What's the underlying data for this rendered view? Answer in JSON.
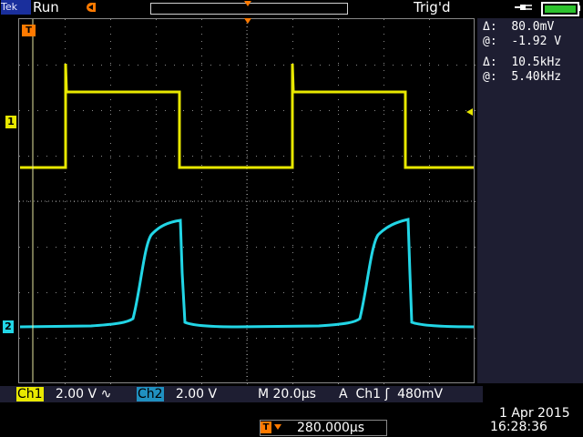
{
  "header": {
    "brand": "Tek",
    "acquisition_state": "Run",
    "trigger_state": "Trig'd"
  },
  "readouts": {
    "cursor_v": {
      "delta_label": "Δ:",
      "delta_value": "80.0mV",
      "at_label": "@:",
      "at_value": "-1.92 V"
    },
    "cursor_t": {
      "delta_label": "Δ:",
      "delta_value": "10.5kHz",
      "at_label": "@:",
      "at_value": "5.40kHz"
    }
  },
  "markers": {
    "trigger": "T",
    "ch1": "1",
    "ch2": "2"
  },
  "bottom": {
    "ch1_label": "Ch1",
    "ch1_scale": "2.00 V",
    "ch1_coupling_symbol": "∿",
    "ch2_label": "Ch2",
    "ch2_scale": "2.00 V",
    "timebase": "M 20.0µs",
    "trigger_mode": "A",
    "trigger_source": "Ch1",
    "trigger_slope_symbol": "ʃ",
    "trigger_level": "480mV",
    "trigger_delay": "280.000µs",
    "date": "1 Apr  2015",
    "time": "16:28:36"
  },
  "colors": {
    "ch1": "#e8e800",
    "ch2": "#22d6e6",
    "trigger": "#ff7a00",
    "grid": "#8a8a8a",
    "panel": "#1e1e32"
  }
}
